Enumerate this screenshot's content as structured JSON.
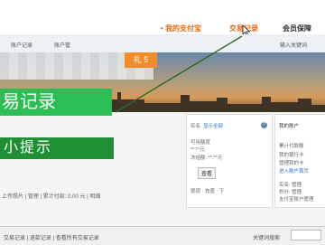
{
  "topnav": {
    "home": "• 我的支付宝",
    "trade": "交易记录",
    "protect": "会员保障"
  },
  "subnav": {
    "item1": "账户记录",
    "item2": "账户管",
    "search_hint": "输入关键词"
  },
  "banner": {
    "tab_label": "礼 5"
  },
  "overlay": {
    "title": "易记录",
    "subtitle": "小提示"
  },
  "panel_mid": {
    "label": "实名",
    "link": "显示全部",
    "line1": "可用额度",
    "line2": "**.**元",
    "line3": "冻结额: **.**元",
    "button": "查看",
    "line4": "提现 · 充值 · 下"
  },
  "panel_right": {
    "title": "我的账户",
    "line1": "累计付款额",
    "line2": "我的银行卡",
    "line3": "管理我的卡",
    "link": "进入账户首页",
    "line4": "实名: 管理",
    "line5": "积分: 管理",
    "line6": "支付宝账户管理"
  },
  "lower_row": {
    "text": "上传照片 | 管理 | 累计付款: 0.00 元 | 明细"
  },
  "bottom": {
    "left": "交易记录 | 退款记录 | 查看所有交易记录",
    "right": "关键词搜索"
  },
  "colors": {
    "accent_orange": "#e8660c",
    "green_title": "#2cbe55",
    "green_sub": "#1f8f33",
    "tab_orange": "#f28c28"
  }
}
